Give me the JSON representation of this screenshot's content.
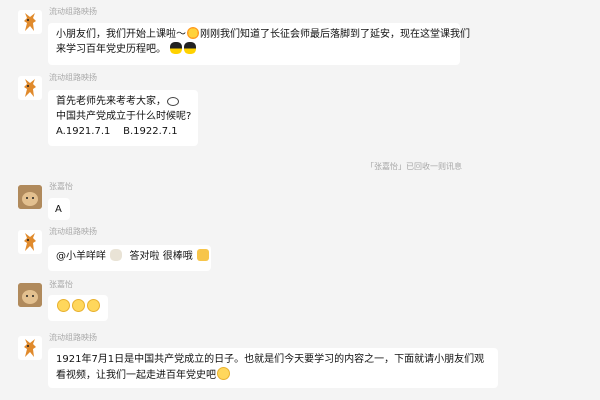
{
  "messages": [
    {
      "sender": "流动组路映扬",
      "lines": [
        "小朋友们，我们开始上课啦～",
        "刚刚我们知道了长征会师最后落脚到了延安，现在这堂课我们",
        "来学习百年党史历程吧。"
      ]
    },
    {
      "sender": "流动组路映扬",
      "lines": [
        "首先老师先来考考大家，",
        "中国共产党成立于什么时候呢?",
        "A.1921.7.1",
        "B.1922.7.1"
      ]
    },
    {
      "sender": "张嘉怡",
      "lines": [
        "A"
      ]
    },
    {
      "sender": "流动组路映扬",
      "lines": [
        "@小羊咩咩",
        "答对啦 很棒哦"
      ]
    },
    {
      "sender": "张嘉怡",
      "lines": []
    },
    {
      "sender": "流动组路映扬",
      "lines": [
        "1921年7月1日是中国共产党成立的日子。也就是们今天要学习的内容之一，下面就请小朋友们观",
        "看视频，让我们一起走进百年党史吧"
      ]
    }
  ],
  "system_notice": "「张嘉怡」已回收一则讯息",
  "icons": {
    "sun": "sun-emoji-icon",
    "penguin": "penguin-emoji-icon",
    "eyes": "eyes-emoji-icon",
    "sheep": "sheep-emoji-icon",
    "thumb": "thumbs-up-emoji-icon",
    "face": "smiling-face-emoji-icon"
  }
}
